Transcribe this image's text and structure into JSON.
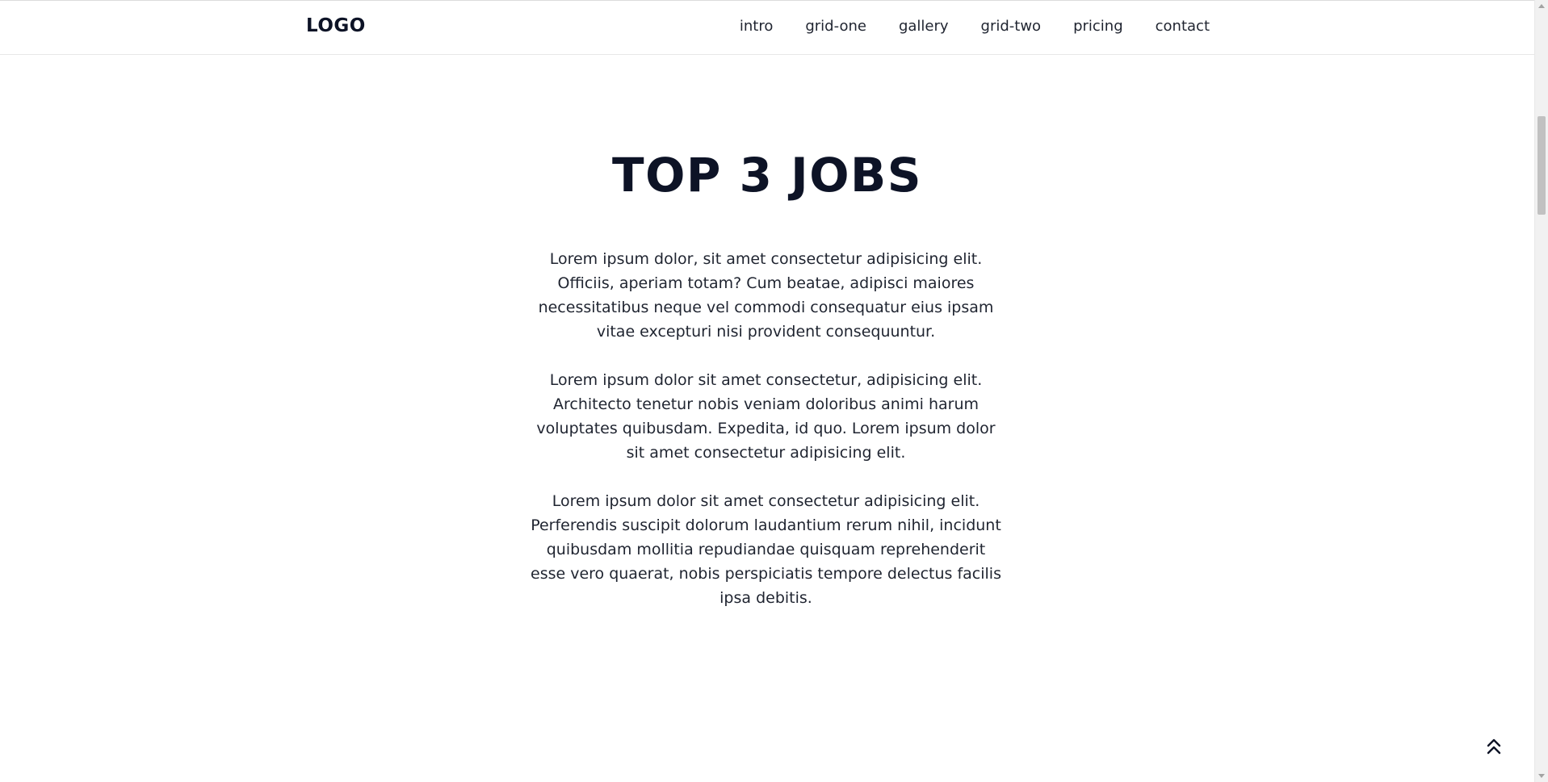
{
  "nav": {
    "logo": "LOGO",
    "links": [
      {
        "label": "intro"
      },
      {
        "label": "grid-one"
      },
      {
        "label": "gallery"
      },
      {
        "label": "grid-two"
      },
      {
        "label": "pricing"
      },
      {
        "label": "contact"
      }
    ]
  },
  "section": {
    "title": "TOP 3 JOBS",
    "paragraphs": [
      "Lorem ipsum dolor, sit amet consectetur adipisicing elit. Officiis, aperiam totam? Cum beatae, adipisci maiores necessitatibus neque vel commodi consequatur eius ipsam vitae excepturi nisi provident consequuntur.",
      "Lorem ipsum dolor sit amet consectetur, adipisicing elit. Architecto tenetur nobis veniam doloribus animi harum voluptates quibusdam. Expedita, id quo. Lorem ipsum dolor sit amet consectetur adipisicing elit.",
      "Lorem ipsum dolor sit amet consectetur adipisicing elit. Perferendis suscipit dolorum laudantium rerum nihil, incidunt quibusdam mollitia repudiandae quisquam reprehenderit esse vero quaerat, nobis perspiciatis tempore delectus facilis ipsa debitis."
    ]
  },
  "icons": {
    "back_to_top": "double-chevron-up-icon"
  },
  "colors": {
    "heading": "#0d1326",
    "text": "#1f2430",
    "background": "#ffffff",
    "border": "#e7e7e7"
  }
}
